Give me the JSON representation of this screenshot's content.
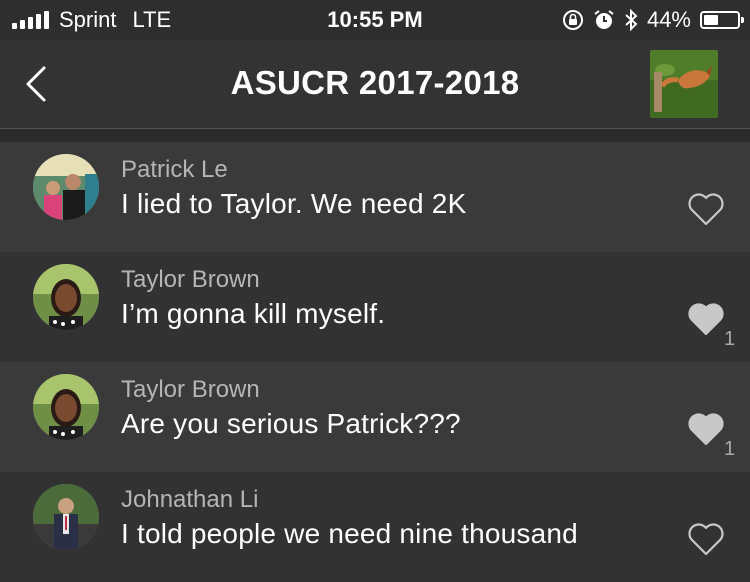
{
  "status_bar": {
    "carrier": "Sprint",
    "network": "LTE",
    "time": "10:55 PM",
    "battery": "44%",
    "battery_level": 0.44,
    "icons": [
      "signal-icon",
      "orientation-lock-icon",
      "alarm-icon",
      "bluetooth-icon",
      "battery-icon"
    ]
  },
  "nav": {
    "title": "ASUCR 2017-2018",
    "back_icon": "chevron-left-icon"
  },
  "messages": [
    {
      "name": "Patrick Le",
      "text": "I lied to Taylor. We need 2K",
      "liked": false,
      "likes": ""
    },
    {
      "name": "Taylor Brown",
      "text": "I’m gonna kill myself.",
      "liked": true,
      "likes": "1"
    },
    {
      "name": "Taylor Brown",
      "text": "Are you serious Patrick???",
      "liked": true,
      "likes": "1"
    },
    {
      "name": "Johnathan Li",
      "text": "I told people we need nine thousand",
      "liked": false,
      "likes": ""
    }
  ],
  "colors": {
    "background": "#2b2b2b",
    "nav": "#333333",
    "row": "#3a3a3a",
    "row_alt": "#323232",
    "name_text": "#b5b5b5",
    "heart": "#c8c8c8"
  }
}
